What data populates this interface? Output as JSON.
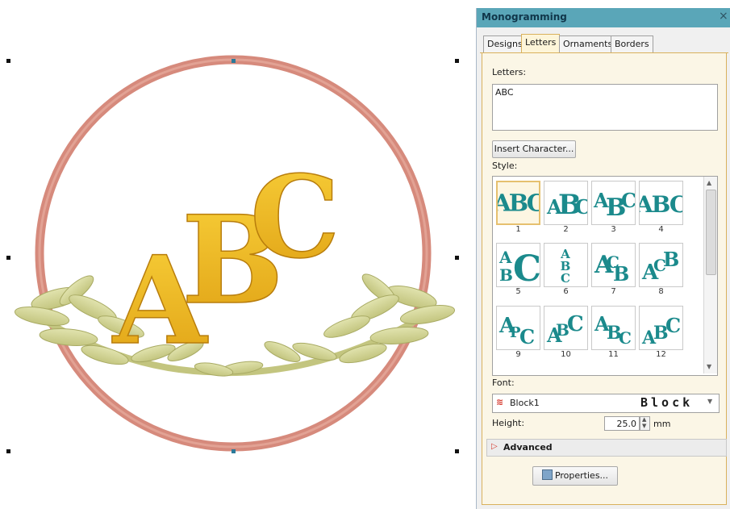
{
  "panel": {
    "title": "Monogramming",
    "close_glyph": "×",
    "tabs": [
      {
        "label": "Designs",
        "active": false
      },
      {
        "label": "Letters",
        "active": true
      },
      {
        "label": "Ornaments",
        "active": false
      },
      {
        "label": "Borders",
        "active": false
      }
    ],
    "letters_label": "Letters:",
    "letters_value": "ABC",
    "insert_character_label": "Insert Character...",
    "style_label": "Style:",
    "styles": [
      {
        "number": "1",
        "selected": true
      },
      {
        "number": "2",
        "selected": false
      },
      {
        "number": "3",
        "selected": false
      },
      {
        "number": "4",
        "selected": false
      },
      {
        "number": "5",
        "selected": false
      },
      {
        "number": "6",
        "selected": false
      },
      {
        "number": "7",
        "selected": false
      },
      {
        "number": "8",
        "selected": false
      },
      {
        "number": "9",
        "selected": false
      },
      {
        "number": "10",
        "selected": false
      },
      {
        "number": "11",
        "selected": false
      },
      {
        "number": "12",
        "selected": false
      }
    ],
    "font_label": "Font:",
    "font_value": "Block1",
    "font_preview": "Block",
    "height_label": "Height:",
    "height_value": "25.0",
    "height_unit": "mm",
    "advanced_label": "Advanced",
    "properties_label": "Properties..."
  },
  "canvas": {
    "monogram_text": [
      "A",
      "B",
      "C"
    ]
  },
  "colors": {
    "titlebar": "#5aa6b8",
    "ring": "#d68a7c",
    "letters_gold": "#f3b920",
    "laurel": "#d2d496",
    "thumb_teal": "#1b8a8c",
    "tab_active_border": "#d9b15c"
  },
  "icons": [
    "close-icon",
    "font-type-icon",
    "chevron-down-icon",
    "spin-up-icon",
    "spin-down-icon",
    "expand-arrow-icon",
    "properties-icon"
  ]
}
